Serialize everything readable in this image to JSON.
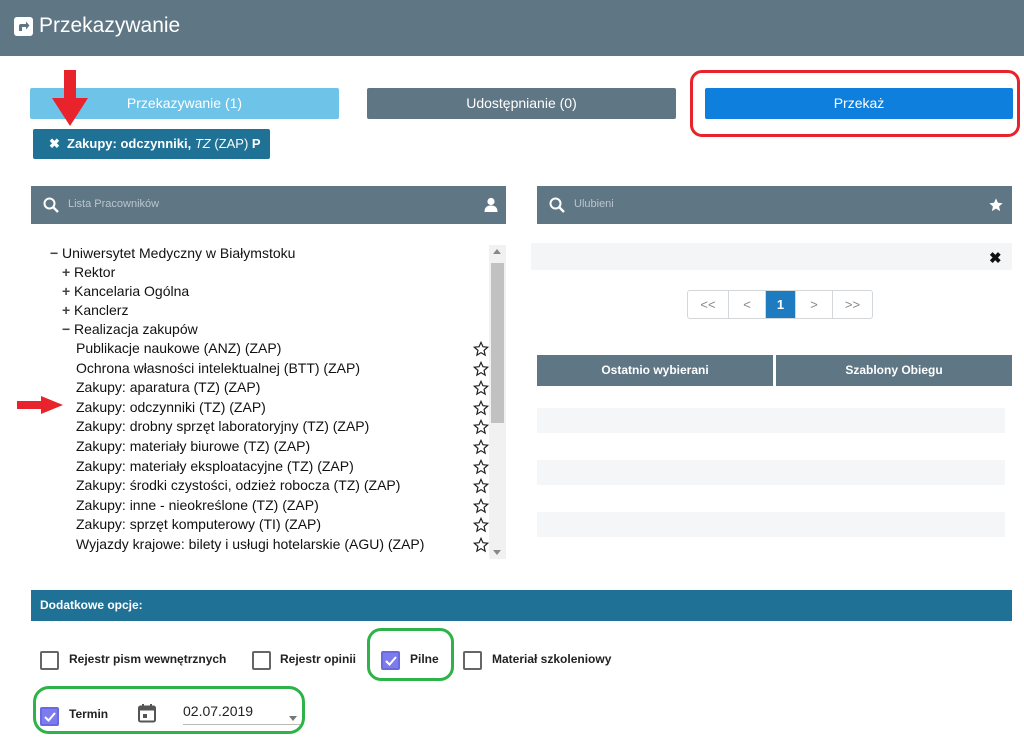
{
  "header": {
    "title": "Przekazywanie"
  },
  "tabs": {
    "forward_label": "Przekazywanie (1)",
    "share_label": "Udostępnianie (0)",
    "submit_label": "Przekaż"
  },
  "chip": {
    "prefix": "Zakupy: odczynniki, ",
    "code": "TZ",
    "unit": " (ZAP) ",
    "suffix": "P"
  },
  "search": {
    "employees_placeholder": "Lista Pracowników",
    "favorites_placeholder": "Ulubieni"
  },
  "tree": {
    "root": "Uniwersytet Medyczny w Białymstoku",
    "children": [
      {
        "sign": "+",
        "label": "Rektor"
      },
      {
        "sign": "+",
        "label": "Kancelaria Ogólna"
      },
      {
        "sign": "+",
        "label": "Kanclerz"
      },
      {
        "sign": "−",
        "label": "Realizacja zakupów"
      }
    ],
    "leaves": [
      "Publikacje naukowe (ANZ) (ZAP)",
      "Ochrona własności intelektualnej (BTT) (ZAP)",
      "Zakupy: aparatura (TZ) (ZAP)",
      "Zakupy: odczynniki (TZ) (ZAP)",
      "Zakupy: drobny sprzęt laboratoryjny (TZ) (ZAP)",
      "Zakupy: materiały biurowe (TZ) (ZAP)",
      "Zakupy: materiały eksploatacyjne (TZ) (ZAP)",
      "Zakupy: środki czystości, odzież robocza (TZ) (ZAP)",
      "Zakupy: inne - nieokreślone (TZ) (ZAP)",
      "Zakupy: sprzęt komputerowy (TI) (ZAP)",
      "Wyjazdy krajowe: bilety i usługi hotelarskie (AGU) (ZAP)"
    ]
  },
  "pager": {
    "first": "<<",
    "prev": "<",
    "current": "1",
    "next": ">",
    "last": ">>"
  },
  "favorites_tabs": {
    "recent": "Ostatnio wybierani",
    "templates": "Szablony Obiegu"
  },
  "options": {
    "title": "Dodatkowe opcje:",
    "internal_register": "Rejestr pism wewnętrznych",
    "opinion_register": "Rejestr opinii",
    "urgent": "Pilne",
    "training": "Materiał szkoleniowy",
    "deadline": "Termin",
    "deadline_value": "02.07.2019",
    "urgent_checked": true,
    "deadline_checked": true
  },
  "colors": {
    "header": "#5f7684",
    "accent": "#0f7fdd",
    "active_tab": "#6ec3e8",
    "options_bar": "#1f7196",
    "annotation_red": "#e8232b",
    "annotation_green": "#2db34a"
  }
}
